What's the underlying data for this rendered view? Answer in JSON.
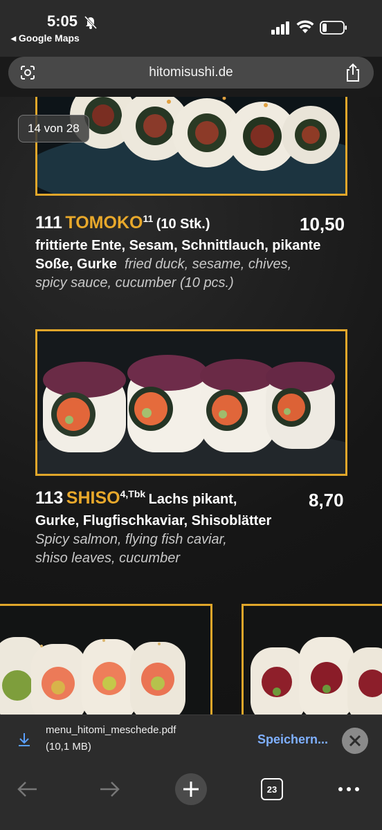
{
  "status_bar": {
    "time": "5:05",
    "back_app": "◂ Google Maps"
  },
  "url_bar": {
    "url": "hitomisushi.de"
  },
  "gallery": {
    "counter": "14 von 28"
  },
  "items": [
    {
      "number": "111",
      "name": "TOMOKO",
      "sup": "11",
      "qty": "(10 Stk.)",
      "price": "10,50",
      "desc_de_1": "frittierte Ente, Sesam, Schnittlauch, pikante",
      "desc_de_2": "Soße, Gurke",
      "desc_en_1": "fried duck, sesame, chives,",
      "desc_en_2": "spicy sauce, cucumber (10 pcs.)"
    },
    {
      "number": "113",
      "name": "SHISO",
      "sup": "4,Tbk",
      "inline_de": "Lachs pikant,",
      "price": "8,70",
      "desc_de_2": "Gurke, Flugfischkaviar, Shisoblätter",
      "desc_en_1": "Spicy salmon, flying fish caviar,",
      "desc_en_2": "shiso leaves, cucumber"
    }
  ],
  "download": {
    "filename": "menu_hitomi_meschede.pdf",
    "size": "(10,1 MB)",
    "save_label": "Speichern..."
  },
  "toolbar": {
    "tabs_count": "23"
  },
  "colors": {
    "accent_gold": "#e0a62a",
    "link_blue": "#7fb0ff"
  }
}
